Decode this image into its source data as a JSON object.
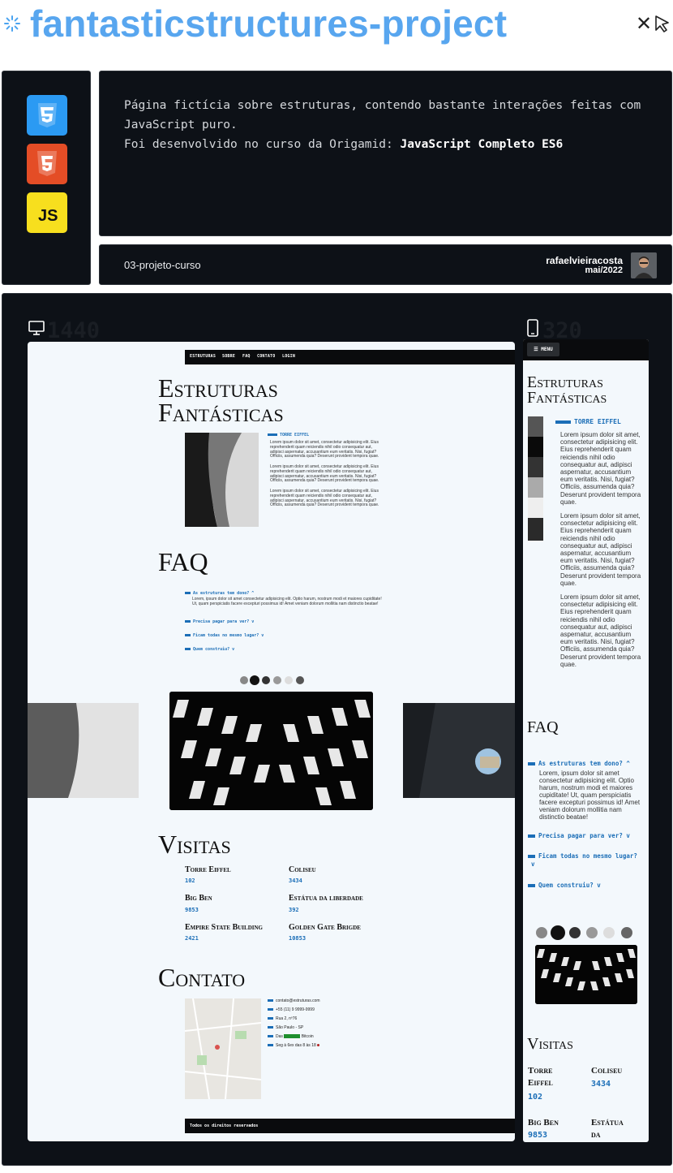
{
  "header": {
    "title": "fantasticstructures-project",
    "spinner_icon": "loading-icon",
    "close_glyph": "✕"
  },
  "tech": [
    "css3",
    "html5",
    "js"
  ],
  "tech_labels": {
    "js": "JS"
  },
  "description": {
    "line1": "Página fictícia sobre estruturas, contendo bastante interações feitas com",
    "line2": "JavaScript puro.",
    "line3_prefix": "Foi desenvolvido no curso da Origamid: ",
    "line3_bold": "JavaScript Completo ES6"
  },
  "meta": {
    "folder": "03-projeto-curso",
    "author": "rafaelvieiracosta",
    "date": "mai/2022"
  },
  "preview": {
    "desktop_label": "1440",
    "mobile_label": "320",
    "desktop": {
      "nav": [
        "ESTRUTURAS",
        "SOBRE",
        "FAQ",
        "CONTATO",
        "LOGIN"
      ],
      "h1_line1": "Estruturas",
      "h1_line2": "Fantásticas",
      "section_title": "TORRE EIFFEL",
      "lorem1": "Lorem ipsum dolor sit amet, consectetur adipisicing elit. Eius reprehenderit quam reiciendis nihil odio consequatur aut, adipisci aspernatur, accusantium eum veritatis. Nisi, fugiat? Officiis, assumenda quia? Deserunt provident tempora quae.",
      "lorem2": "Lorem ipsum dolor sit amet, consectetur adipisicing elit. Eius reprehenderit quam reiciendis nihil odio consequatur aut, adipisci aspernatur, accusantium eum veritatis. Nisi, fugiat? Officiis, assumenda quia? Deserunt provident tempora quae.",
      "lorem3": "Lorem ipsum dolor sit amet, consectetur adipisicing elit. Eius reprehenderit quam reiciendis nihil odio consequatur aut, adipisci aspernatur, accusantium eum veritatis. Nisi, fugiat? Officiis, assumenda quia? Deserunt provident tempora quae.",
      "faq_title": "FAQ",
      "faq": [
        "As estruturas tem dono? ^",
        "Precisa pagar para ver? v",
        "Ficam todas no mesmo lugar? v",
        "Quem construiu? v"
      ],
      "faq_answer": "Lorem, ipsum dolor sit amet consectetur adipisicing elit. Optio harum, nostrum modi et maiores cupiditate! Ut, quam perspiciatis facere excepturi possimus id! Amet veniam dolorum mollitia nam distinctio beatae!",
      "visitas_title": "Visitas",
      "visitas": [
        {
          "name": "Torre Eiffel",
          "count": "102"
        },
        {
          "name": "Coliseu",
          "count": "3434"
        },
        {
          "name": "Big Ben",
          "count": "9853"
        },
        {
          "name": "Estátua da liberdade",
          "count": "392"
        },
        {
          "name": "Empire State Building",
          "count": "2421"
        },
        {
          "name": "Golden Gate Brigde",
          "count": "10853"
        }
      ],
      "contato_title": "Contato",
      "contato": [
        "contato@estruturas.com",
        "+55 (11) 9 9999-9999",
        "Rua 2, nº76",
        "São Paulo - SP",
        "Bitcoin",
        "Seg à 6ex das 8 às 18"
      ],
      "contato_dot": "Das",
      "footer": "Todos os direitos reservados"
    },
    "mobile": {
      "menu": "☰ MENU",
      "h1_line1": "Estruturas",
      "h1_line2": "Fantásticas",
      "section_title": "TORRE EIFFEL",
      "lorem1": "Lorem ipsum dolor sit amet, consectetur adipisicing elit. Eius reprehenderit quam reiciendis nihil odio consequatur aut, adipisci aspernatur, accusantium eum veritatis. Nisi, fugiat? Officiis, assumenda quia? Deserunt provident tempora quae.",
      "lorem2": "Lorem ipsum dolor sit amet, consectetur adipisicing elit. Eius reprehenderit quam reiciendis nihil odio consequatur aut, adipisci aspernatur, accusantium eum veritatis. Nisi, fugiat? Officiis, assumenda quia? Deserunt provident tempora quae.",
      "lorem3": "Lorem ipsum dolor sit amet, consectetur adipisicing elit. Eius reprehenderit quam reiciendis nihil odio consequatur aut, adipisci aspernatur, accusantium eum veritatis. Nisi, fugiat? Officiis, assumenda quia? Deserunt provident tempora quae.",
      "faq_title": "FAQ",
      "faq": [
        "As estruturas tem dono? ^",
        "Precisa pagar para ver? v",
        "Ficam todas no mesmo lugar?",
        "Quem construiu? v"
      ],
      "faq3_arrow": "v",
      "faq_answer": "Lorem, ipsum dolor sit amet consectetur adipisicing elit. Optio harum, nostrum modi et maiores cupiditate! Ut, quam perspiciatis facere excepturi possimus id! Amet veniam dolorum mollitia nam distinctio beatae!",
      "visitas_title": "Visitas",
      "v1_name_a": "Torre",
      "v1_name_b": "Eiffel",
      "v1_count": "102",
      "v2_name": "Coliseu",
      "v2_count": "3434",
      "v3_name": "Big Ben",
      "v3_count": "9853",
      "v4_name_a": "Estátua",
      "v4_name_b": "da"
    }
  }
}
